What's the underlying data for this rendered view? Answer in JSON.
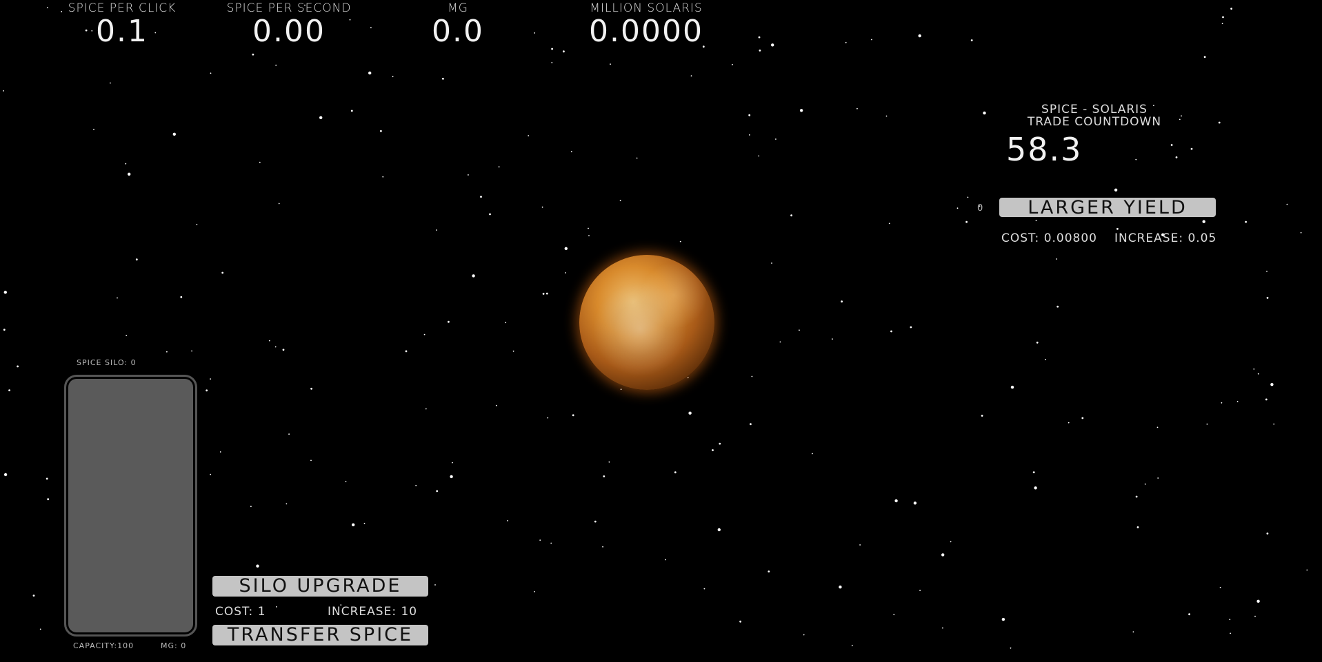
{
  "stats": [
    {
      "label": "SPICE PER CLICK",
      "value": "0.1"
    },
    {
      "label": "SPICE PER SECOND",
      "value": "0.00"
    },
    {
      "label": "MG",
      "value": "0.0"
    },
    {
      "label": "MILLION SOLARIS",
      "value": "0.0000"
    }
  ],
  "trade": {
    "title_line1": "SPICE - SOLARIS",
    "title_line2": "TRADE COUNTDOWN",
    "countdown": "58.3",
    "yield_count": "0",
    "larger_yield_label": "LARGER YIELD",
    "cost": "COST: 0.00800",
    "increase": "INCREASE: 0.05"
  },
  "silo": {
    "label": "SPICE SILO: 0",
    "capacity": "CAPACITY:100",
    "mg": "MG: 0",
    "fill_percent": 0,
    "upgrade_label": "SILO UPGRADE",
    "upgrade_cost": "COST: 1",
    "upgrade_increase": "INCREASE: 10",
    "transfer_label": "TRANSFER SPICE"
  },
  "colors": {
    "background": "#000000",
    "button": "#c4c4c4",
    "silo": "#5a5a5a"
  },
  "icons": {
    "planet": "planet-arrakis"
  }
}
